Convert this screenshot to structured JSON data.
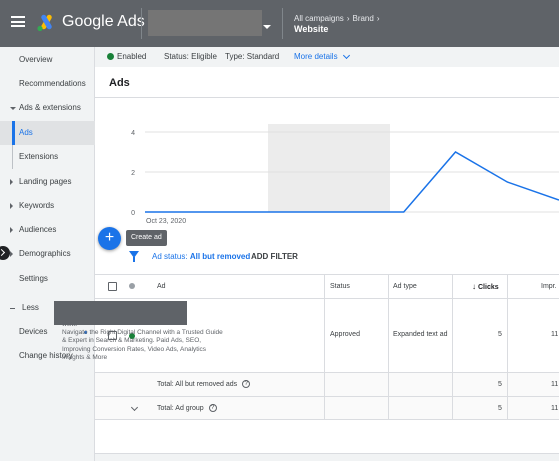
{
  "header": {
    "product_name": "Google Ads",
    "breadcrumb": [
      "All campaigns",
      "Brand"
    ],
    "breadcrumb_title": "Website"
  },
  "sidebar": {
    "items": [
      {
        "label": "Overview"
      },
      {
        "label": "Recommendations"
      },
      {
        "label": "Ads & extensions"
      },
      {
        "label": "Ads"
      },
      {
        "label": "Extensions"
      },
      {
        "label": "Landing pages"
      },
      {
        "label": "Keywords"
      },
      {
        "label": "Audiences"
      },
      {
        "label": "Demographics"
      },
      {
        "label": "Settings"
      },
      {
        "label": "Less"
      },
      {
        "label": "Devices"
      },
      {
        "label": "Change history"
      }
    ]
  },
  "status_bar": {
    "enabled": "Enabled",
    "status": "Status: Eligible",
    "type": "Type: Standard",
    "more_details": "More details"
  },
  "main": {
    "title": "Ads",
    "fab_tooltip": "Create ad",
    "fab_symbol": "+",
    "filter_prefix": "Ad status:",
    "filter_value": "All but removed",
    "add_filter": "ADD FILTER"
  },
  "chart_data": {
    "type": "line",
    "x": [
      "Oct 23, 2020",
      "",
      "",
      "",
      "",
      "",
      "",
      "",
      ""
    ],
    "y_ticks": [
      "0",
      "2",
      "4"
    ],
    "ylim": [
      0,
      4
    ],
    "series": [
      {
        "values": [
          0,
          0,
          0,
          0,
          0,
          0,
          3,
          1.5,
          0.6
        ]
      }
    ],
    "x_tick_label": "Oct 23, 2020",
    "color": "#1a73e8"
  },
  "table": {
    "columns": [
      "Ad",
      "Status",
      "Ad type",
      "Clicks",
      "Impr."
    ],
    "rows": [
      {
        "ad_url": "www.",
        "ad_text": "Navigate the Right Digital Channel with a Trusted Guide & Expert in Search & Marketing. Paid Ads, SEO, Improving Conversion Rates, Video Ads, Analytics Insights & More",
        "status": "Approved",
        "ad_type": "Expanded text ad",
        "clicks": "5",
        "impr": "11"
      }
    ],
    "total_removed": {
      "label": "Total: All but removed ads",
      "clicks": "5",
      "impr": "11"
    },
    "total_group": {
      "label": "Total: Ad group",
      "clicks": "5",
      "impr": "11"
    }
  },
  "colors": {
    "accent": "#1a73e8",
    "header": "#5f6368",
    "enabled_green": "#188038"
  },
  "icons": [
    "menu-icon",
    "google-ads-logo-icon",
    "dropdown-caret-icon",
    "chevron-right-icon",
    "status-dot-icon",
    "add-icon",
    "filter-icon",
    "help-icon",
    "chevron-down-icon",
    "sort-arrow-icon"
  ]
}
